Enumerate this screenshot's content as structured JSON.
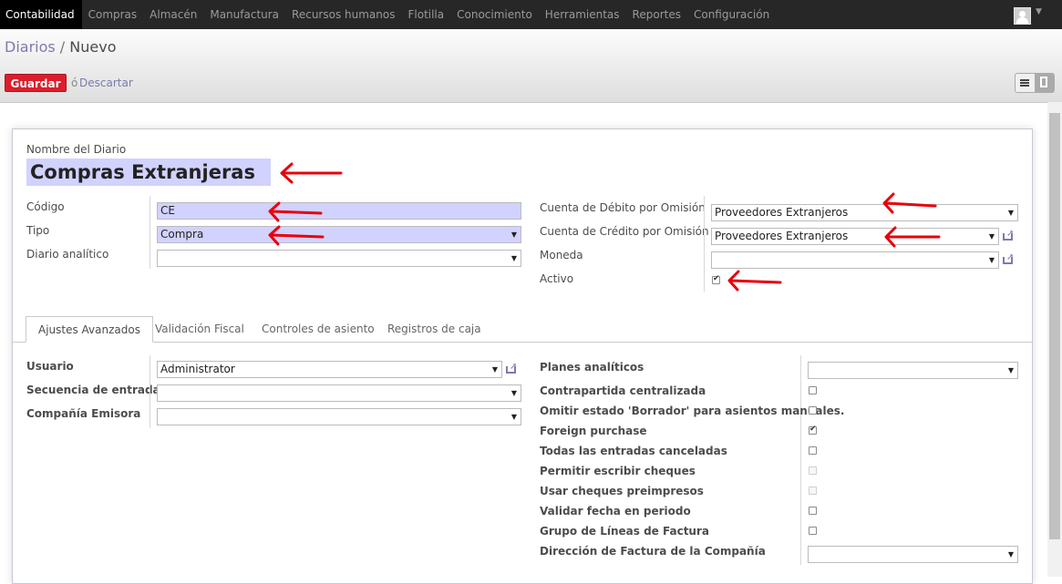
{
  "topbar": {
    "menu": [
      "Contabilidad",
      "Compras",
      "Almacén",
      "Manufactura",
      "Recursos humanos",
      "Flotilla",
      "Conocimiento",
      "Herramientas",
      "Reportes",
      "Configuración"
    ],
    "active_menu": "Contabilidad"
  },
  "breadcrumb": {
    "parent": "Diarios",
    "separator": " / ",
    "current": "Nuevo"
  },
  "buttons": {
    "save": "Guardar",
    "or": "ó",
    "discard": "Descartar"
  },
  "form": {
    "name_label": "Nombre del Diario",
    "name_value": "Compras Extranjeras",
    "left": {
      "code_label": "Código",
      "code_value": "CE",
      "type_label": "Tipo",
      "type_value": "Compra",
      "analytic_label": "Diario analítico",
      "analytic_value": ""
    },
    "right": {
      "debit_label": "Cuenta de Débito por Omisión",
      "debit_value": "Proveedores Extranjeros",
      "credit_label": "Cuenta de Crédito por Omisión",
      "credit_value": "Proveedores Extranjeros",
      "currency_label": "Moneda",
      "currency_value": "",
      "active_label": "Activo",
      "active_checked": true
    }
  },
  "tabs": [
    "Ajustes Avanzados",
    "Validación Fiscal",
    "Controles de asiento",
    "Registros de caja"
  ],
  "advanced": {
    "user_label": "Usuario",
    "user_value": "Administrator",
    "sequence_label": "Secuencia de entrada",
    "sequence_value": "",
    "company_label": "Compañía Emisora",
    "company_value": "",
    "analytic_plans_label": "Planes analíticos",
    "analytic_plans_value": "",
    "checks": [
      {
        "label": "Contrapartida centralizada",
        "checked": false,
        "disabled": false
      },
      {
        "label": "Omitir estado 'Borrador' para asientos manuales.",
        "checked": false,
        "disabled": false
      },
      {
        "label": "Foreign purchase",
        "checked": true,
        "disabled": false
      },
      {
        "label": "Todas las entradas canceladas",
        "checked": false,
        "disabled": false
      },
      {
        "label": "Permitir escribir cheques",
        "checked": false,
        "disabled": true
      },
      {
        "label": "Usar cheques preimpresos",
        "checked": false,
        "disabled": true
      },
      {
        "label": "Validar fecha en periodo",
        "checked": false,
        "disabled": false
      },
      {
        "label": "Grupo de Líneas de Factura",
        "checked": false,
        "disabled": false
      }
    ],
    "invoice_address_label": "Dirección de Factura de la Compañía",
    "invoice_address_value": ""
  },
  "colors": {
    "topbar": "#272727",
    "required_field": "#d2d2ff",
    "save_button": "#dc1e2b",
    "link": "#7c7bad",
    "annotation_arrow": "#e8000b"
  },
  "icons": [
    "user-avatar-icon",
    "list-view-icon",
    "form-view-icon",
    "external-link-icon",
    "dropdown-arrow-icon",
    "red-arrow-annotation"
  ]
}
